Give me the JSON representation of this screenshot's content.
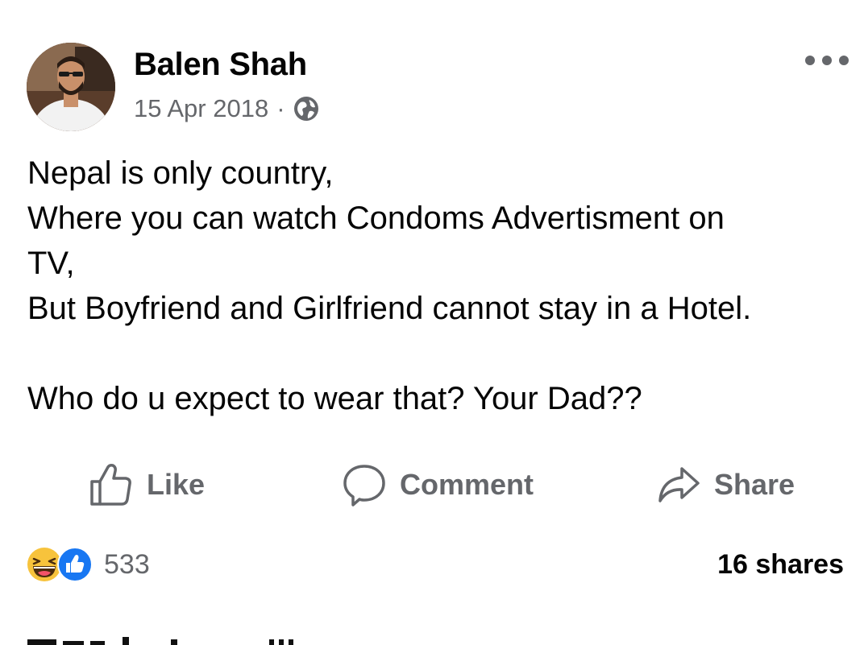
{
  "post": {
    "author_name": "Balen Shah",
    "date": "15 Apr 2018",
    "separator": "·",
    "audience_icon": "globe-icon",
    "more_icon": "more-options-icon",
    "body_lines": [
      "Nepal is only country,",
      "Where you can watch Condoms Advertisment on",
      "TV,",
      "But Boyfriend and Girlfriend cannot stay in a Hotel.",
      "",
      "Who do u expect to wear that? Your Dad??"
    ]
  },
  "actions": {
    "like_label": "Like",
    "comment_label": "Comment",
    "share_label": "Share"
  },
  "stats": {
    "reaction_icons": [
      "haha-reaction-icon",
      "like-reaction-icon"
    ],
    "reaction_count": "533",
    "shares_text": "16 shares"
  },
  "colors": {
    "text_primary": "#050505",
    "text_secondary": "#65676b",
    "like_blue": "#1877f2",
    "haha_yellow": "#f7c33c"
  }
}
